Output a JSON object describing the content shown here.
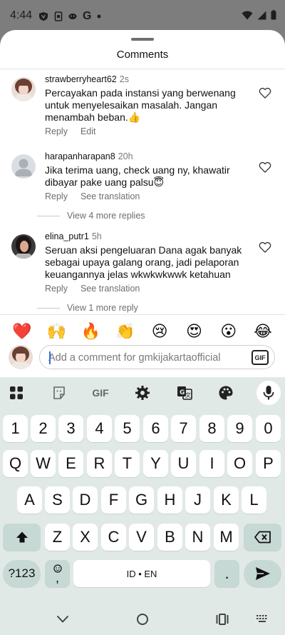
{
  "status_bar": {
    "time": "4:44",
    "icons": [
      "vpn-icon",
      "screenshot-icon",
      "mask-icon",
      "google-icon",
      "dot-icon"
    ],
    "right_icons": [
      "wifi-icon",
      "signal-icon",
      "battery-icon"
    ]
  },
  "sheet": {
    "title": "Comments"
  },
  "comments": [
    {
      "username": "strawberryheart62",
      "time": "2s",
      "text": "Percayakan pada instansi yang berwenang untuk menyelesaikan masalah. Jangan menambah beban.👍",
      "actions": [
        "Reply",
        "Edit"
      ]
    },
    {
      "username": "harapanharapan8",
      "time": "20h",
      "text": "Jika terima uang, check uang ny, khawatir dibayar pake uang palsu😇",
      "actions": [
        "Reply",
        "See translation"
      ],
      "more_replies": "View 4 more replies"
    },
    {
      "username": "elina_putr1",
      "time": "5h",
      "text": "Seruan aksi pengeluaran Dana agak banyak sebagai upaya galang orang, jadi pelaporan keuangannya jelas wkwkwkwwk ketahuan",
      "actions": [
        "Reply",
        "See translation"
      ],
      "more_replies": "View 1 more reply"
    }
  ],
  "emoji_bar": [
    "❤️",
    "🙌",
    "🔥",
    "👏",
    "😢",
    "😍",
    "😮",
    "😂"
  ],
  "composer": {
    "placeholder": "Add a comment for gmkijakartaofficial",
    "gif_label": "GIF"
  },
  "keyboard": {
    "toolbar": [
      "apps-icon",
      "sticker-icon",
      "gif-icon",
      "settings-icon",
      "translate-icon",
      "palette-icon",
      "mic-icon"
    ],
    "toolbar_gif": "GIF",
    "row_numbers": [
      "1",
      "2",
      "3",
      "4",
      "5",
      "6",
      "7",
      "8",
      "9",
      "0"
    ],
    "row1": [
      "Q",
      "W",
      "E",
      "R",
      "T",
      "Y",
      "U",
      "I",
      "O",
      "P"
    ],
    "row2": [
      "A",
      "S",
      "D",
      "F",
      "G",
      "H",
      "J",
      "K",
      "L"
    ],
    "row3": [
      "Z",
      "X",
      "C",
      "V",
      "B",
      "N",
      "M"
    ],
    "symbols_label": "?123",
    "comma_label": ",",
    "space_label": "ID • EN",
    "period_label": "."
  },
  "nav_bar": [
    "back-icon",
    "home-icon",
    "recents-icon",
    "keyboard-switch-icon"
  ]
}
